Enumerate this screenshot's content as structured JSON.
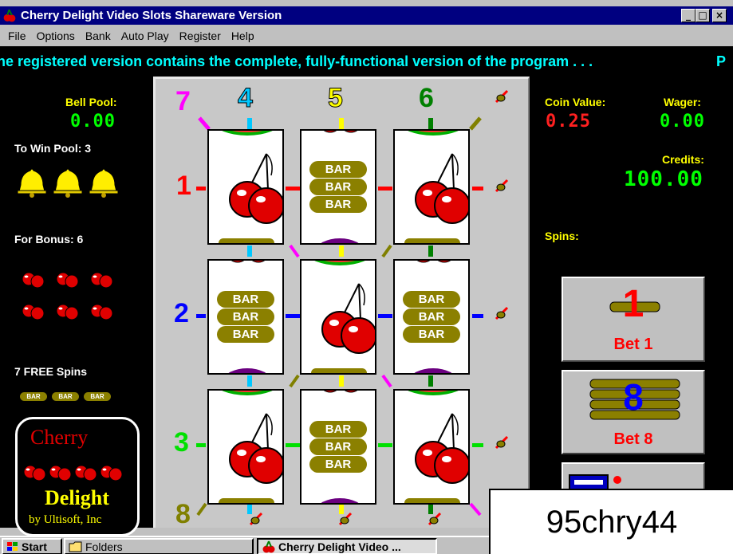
{
  "window": {
    "title": "Cherry Delight Video Slots Shareware Version",
    "controls": [
      "_",
      "□",
      "×"
    ]
  },
  "menu": [
    "File",
    "Options",
    "Bank",
    "Auto Play",
    "Register",
    "Help"
  ],
  "ticker": {
    "text": "he registered version contains the complete, fully-functional version of the program . . .",
    "text_tail": "P"
  },
  "left": {
    "bell_pool_label": "Bell Pool:",
    "bell_pool_value": "0.00",
    "to_win_pool": "To Win Pool:  3",
    "for_bonus": "For Bonus:  6",
    "free_spins": "7 FREE Spins",
    "mini_bar": "BAR",
    "logo_cherry": "Cherry",
    "logo_delight": "Delight",
    "logo_by": "by Ultisoft, Inc"
  },
  "lines": {
    "top": [
      "7",
      "4",
      "5",
      "6"
    ],
    "rows": [
      "1",
      "2",
      "3"
    ],
    "bottom": "8"
  },
  "reels": {
    "bar_text": "BAR",
    "grid": [
      [
        "cherry",
        "bar3",
        "cherry"
      ],
      [
        "bar3",
        "cherry",
        "bar3"
      ],
      [
        "cherry",
        "bar3",
        "cherry"
      ]
    ]
  },
  "right": {
    "coin_value_label": "Coin Value:",
    "coin_value": "0.25",
    "wager_label": "Wager:",
    "wager": "0.00",
    "credits_label": "Credits:",
    "credits": "100.00",
    "spins_label": "Spins:",
    "bet1_label": "Bet 1",
    "bet1_icon_digit": "1",
    "bet8_label": "Bet 8",
    "bet8_icon_digit": "8"
  },
  "taskbar": {
    "start": "Start",
    "folders": "Folders",
    "active": "Cherry Delight Video ..."
  },
  "overlay_caption": "95chry44",
  "colors": {
    "led_green": "#00ff00",
    "led_red": "#ff2020",
    "label_yellow": "#ffff00",
    "ticker_cyan": "#00ffff",
    "line_red": "#ff0000",
    "line_blue": "#0000ff",
    "line_green": "#00e000",
    "line_magenta": "#ff00ff",
    "line_cyan": "#00c8ff",
    "line_yellow": "#ffff00",
    "line_olive": "#808000",
    "bar_olive": "#8b8000"
  }
}
